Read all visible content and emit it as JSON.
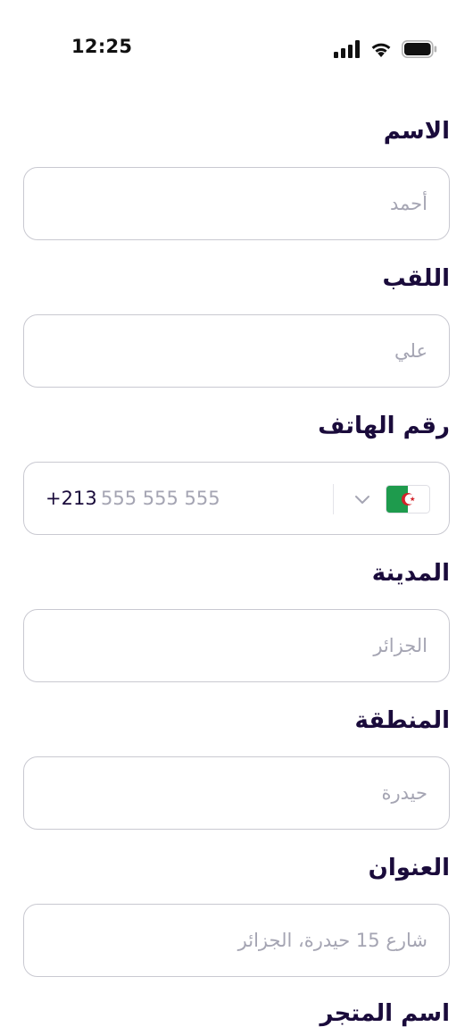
{
  "status_bar": {
    "time": "12:25",
    "icons": [
      "cellular-signal-icon",
      "wifi-icon",
      "battery-icon"
    ]
  },
  "form": {
    "first_name": {
      "label": "الاسم",
      "placeholder": "أحمد"
    },
    "last_name": {
      "label": "اللقب",
      "placeholder": "علي"
    },
    "phone": {
      "label": "رقم الهاتف",
      "country_code": "+213",
      "placeholder": "555 555 555",
      "country_flag": "algeria-flag-icon",
      "dropdown_icon": "chevron-down-icon"
    },
    "city": {
      "label": "المدينة",
      "placeholder": "الجزائر"
    },
    "region": {
      "label": "المنطقة",
      "placeholder": "حيدرة"
    },
    "address": {
      "label": "العنوان",
      "placeholder": "شارع 15 حيدرة، الجزائر"
    },
    "store_name": {
      "label": "اسم المتجر"
    }
  },
  "colors": {
    "label_text": "#1a0b3b",
    "placeholder_text": "#a5a5b3",
    "input_border": "#c9c9d1",
    "flag_green": "#1e9b4d",
    "flag_red": "#d3222a"
  }
}
